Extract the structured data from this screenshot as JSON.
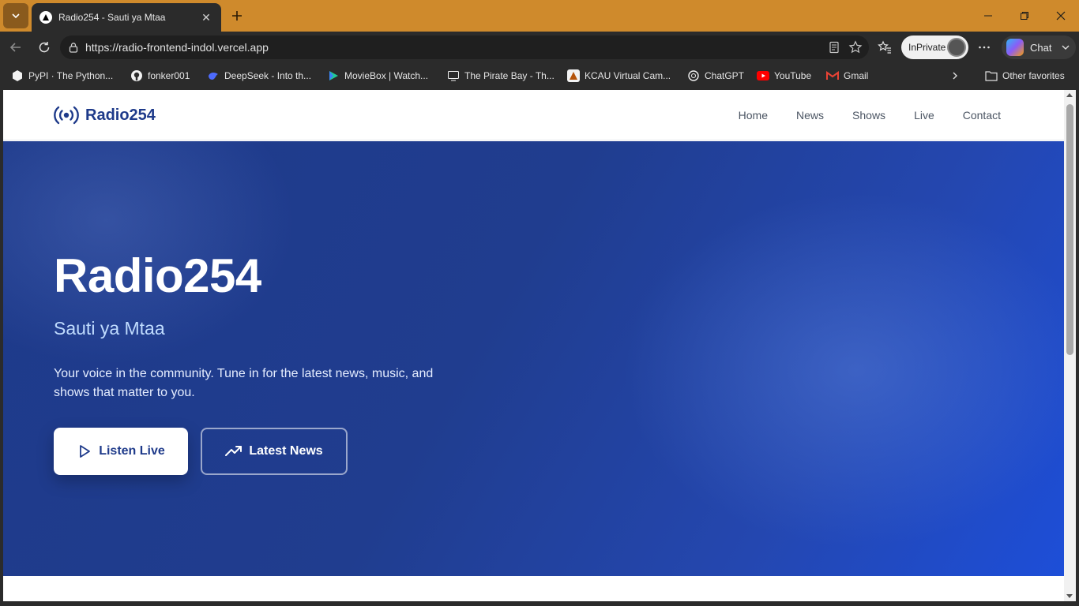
{
  "browser": {
    "tab_title": "Radio254 - Sauti ya Mtaa",
    "url": "https://radio-frontend-indol.vercel.app",
    "inprivate_label": "InPrivate",
    "chat_label": "Chat",
    "titlebar_color": "#cf8a2c",
    "bookmarks": [
      {
        "label": "PyPI · The Python...",
        "icon": "pypi-icon"
      },
      {
        "label": "fonker001",
        "icon": "github-icon"
      },
      {
        "label": "DeepSeek - Into th...",
        "icon": "deepseek-icon"
      },
      {
        "label": "MovieBox | Watch...",
        "icon": "moviebox-icon"
      },
      {
        "label": "The Pirate Bay - Th...",
        "icon": "piratebay-icon"
      },
      {
        "label": "KCAU Virtual Cam...",
        "icon": "kcau-icon"
      },
      {
        "label": "ChatGPT",
        "icon": "chatgpt-icon"
      },
      {
        "label": "YouTube",
        "icon": "youtube-icon"
      },
      {
        "label": "Gmail",
        "icon": "gmail-icon"
      }
    ],
    "other_favorites": "Other favorites"
  },
  "site": {
    "logo": "Radio254",
    "nav": [
      "Home",
      "News",
      "Shows",
      "Live",
      "Contact"
    ],
    "hero": {
      "title": "Radio254",
      "subtitle": "Sauti ya Mtaa",
      "description": "Your voice in the community. Tune in for the latest news, music, and shows that matter to you.",
      "listen_button": "Listen Live",
      "news_button": "Latest News"
    },
    "colors": {
      "brand": "#1e3a8a",
      "hero_end": "#1d4ed8"
    }
  }
}
